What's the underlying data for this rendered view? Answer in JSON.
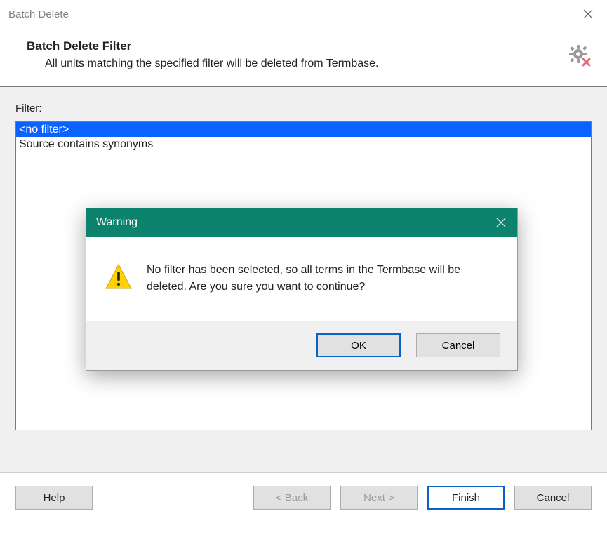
{
  "window": {
    "title": "Batch Delete"
  },
  "header": {
    "heading": "Batch Delete Filter",
    "subheading": "All units matching the specified filter will be deleted from Termbase."
  },
  "filter": {
    "label": "Filter:",
    "items": [
      "<no filter>",
      "Source contains synonyms"
    ],
    "selected_index": 0
  },
  "footer": {
    "help": "Help",
    "back": "< Back",
    "next": "Next >",
    "finish": "Finish",
    "cancel": "Cancel"
  },
  "dialog": {
    "title": "Warning",
    "message": "No filter has been selected, so all terms in the Termbase will be deleted. Are you sure you want to continue?",
    "ok": "OK",
    "cancel": "Cancel"
  }
}
